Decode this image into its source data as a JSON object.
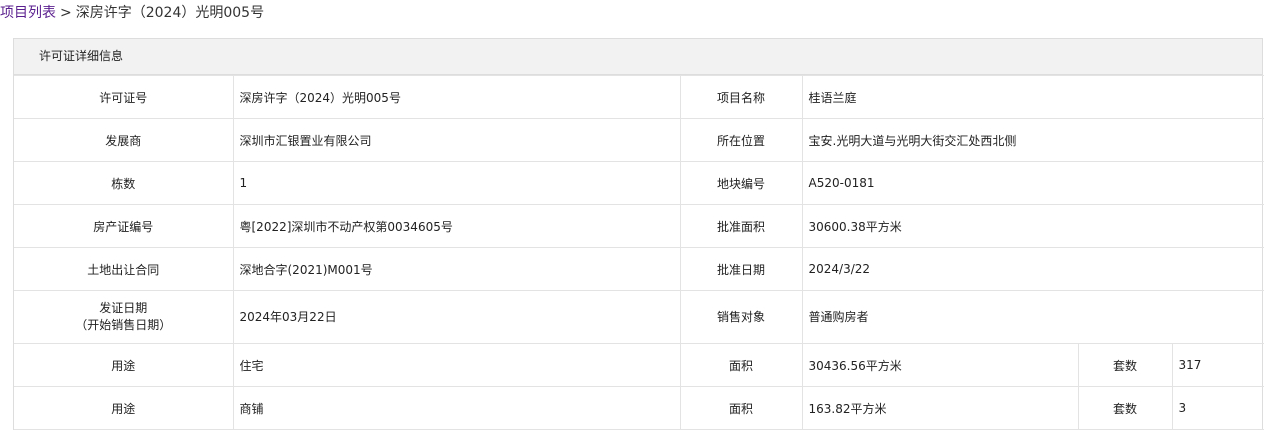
{
  "breadcrumb": {
    "link": "项目列表",
    "separator": ">",
    "current": "深房许字（2024）光明005号"
  },
  "panel": {
    "title": "许可证详细信息"
  },
  "rows": [
    {
      "l1": "许可证号",
      "v1": "深房许字（2024）光明005号",
      "l2": "项目名称",
      "v2": "桂语兰庭"
    },
    {
      "l1": "发展商",
      "v1": "深圳市汇银置业有限公司",
      "l2": "所在位置",
      "v2": "宝安.光明大道与光明大街交汇处西北侧"
    },
    {
      "l1": "栋数",
      "v1": "1",
      "l2": "地块编号",
      "v2": "A520-0181"
    },
    {
      "l1": "房产证编号",
      "v1": "粤[2022]深圳市不动产权第0034605号",
      "l2": "批准面积",
      "v2": "30600.38平方米"
    },
    {
      "l1": "土地出让合同",
      "v1": "深地合字(2021)M001号",
      "l2": "批准日期",
      "v2": "2024/3/22"
    },
    {
      "l1a": "发证日期",
      "l1b": "（开始销售日期）",
      "v1": "2024年03月22日",
      "l2": "销售对象",
      "v2": "普通购房者"
    }
  ],
  "usage_rows": [
    {
      "use_label": "用途",
      "use": "住宅",
      "area_label": "面积",
      "area": "30436.56平方米",
      "sets_label": "套数",
      "sets": "317"
    },
    {
      "use_label": "用途",
      "use": "商铺",
      "area_label": "面积",
      "area": "163.82平方米",
      "sets_label": "套数",
      "sets": "3"
    }
  ]
}
